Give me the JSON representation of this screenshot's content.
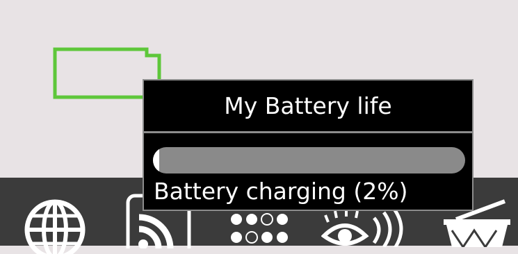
{
  "popup": {
    "title": "My Battery life",
    "status": "Battery charging (2%)",
    "charge_percent": 2
  },
  "colors": {
    "desktop_bg": "#e8e3e5",
    "taskbar_bg": "#3b3b3b",
    "battery_outline": "#5ec73a",
    "popup_bg": "#000000",
    "popup_border": "#8c8c8c",
    "progress_track": "#8a8a8a",
    "progress_fill": "#ffffff"
  },
  "taskbar": {
    "icons": [
      "globe-icon",
      "rss-feed-icon",
      "dots-grid-icon",
      "eye-broadcast-icon",
      "drum-icon"
    ]
  }
}
